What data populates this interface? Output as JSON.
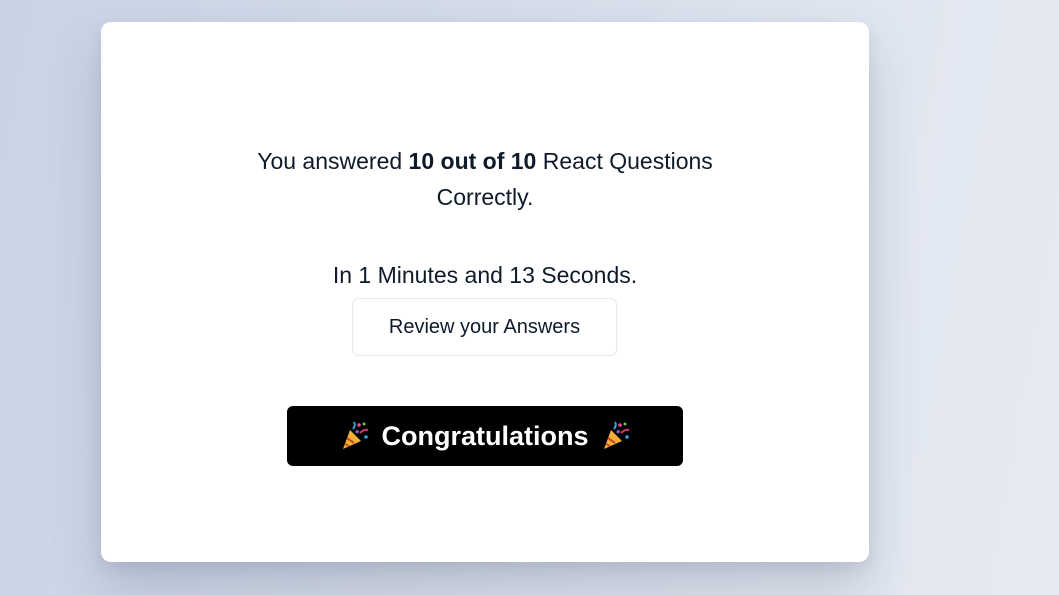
{
  "result": {
    "prefix": "You answered ",
    "score": "10 out of 10",
    "suffix": " React Questions Correctly.",
    "time_text": "In 1 Minutes and 13 Seconds."
  },
  "actions": {
    "review_label": "Review your Answers"
  },
  "banner": {
    "label": "Congratulations",
    "left_icon": "party-popper-icon",
    "right_icon": "party-popper-icon"
  },
  "colors": {
    "text": "#0f1a2a",
    "banner_bg": "#000000",
    "card_bg": "#ffffff"
  }
}
